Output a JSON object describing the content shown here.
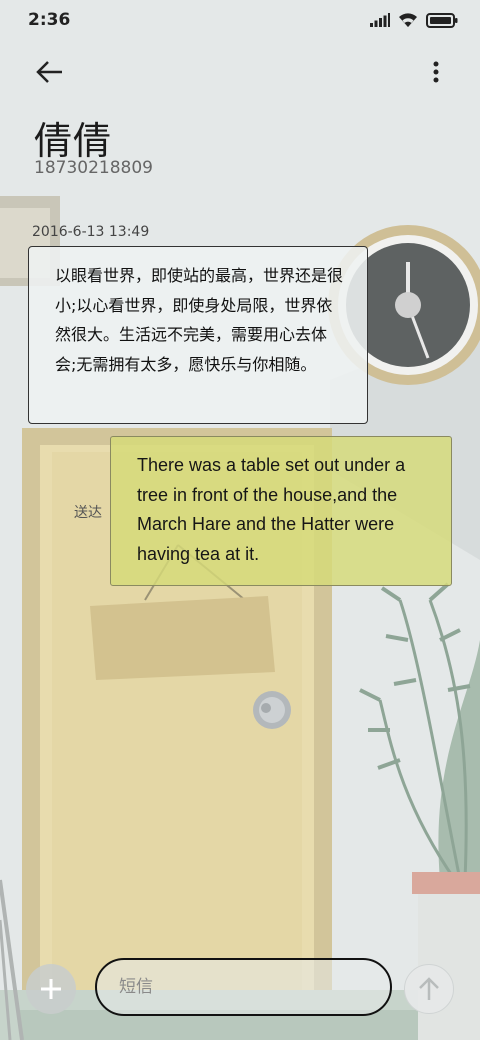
{
  "status_bar": {
    "time": "2:36",
    "icons": [
      "signal-icon",
      "wifi-icon",
      "battery-icon"
    ]
  },
  "toolbar": {
    "back_icon": "arrow-left-icon",
    "more_icon": "more-vertical-icon"
  },
  "contact": {
    "name": "倩倩",
    "number": "18730218809"
  },
  "conversation": {
    "timestamp": "2016-6-13 13:49",
    "incoming_message": "以眼看世界，即使站的最高，世界还是很小;以心看世界，即使身处局限，世界依然很大。生活远不完美，需要用心去体会;无需拥有太多，愿快乐与你相随。",
    "outgoing_message": "There was a table set out under a tree in front of the house,and the March Hare and the Hatter were having tea at it.",
    "outgoing_status": "送达"
  },
  "composer": {
    "placeholder": "短信",
    "add_icon": "plus-icon",
    "send_icon": "arrow-up-icon"
  },
  "colors": {
    "background": "#e4e8e8",
    "outgoing_bubble": "#d6da78",
    "incoming_bubble": "#eef1f1",
    "door": "#e8dcae"
  }
}
